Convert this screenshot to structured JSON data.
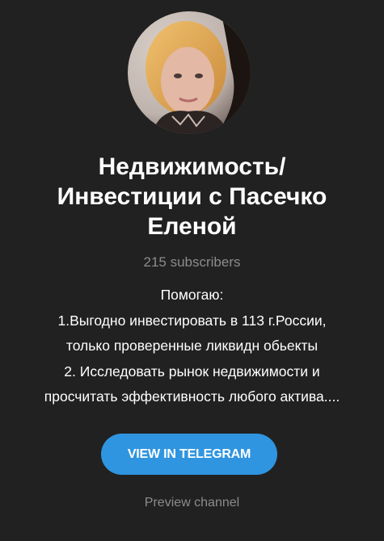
{
  "channel": {
    "title_lines": [
      "Недвижимость/",
      "Инвестиции с Пасечко",
      "Еленой"
    ],
    "subscribers": "215 subscribers",
    "description_lines": [
      "Помогаю:",
      "1.Выгодно инвестировать в 113 г.России,",
      "только проверенные ликвидн обьекты",
      "2. Исследовать рынок недвижимости и",
      "просчитать эффективность любого актива...."
    ]
  },
  "actions": {
    "view_in_telegram": "VIEW IN TELEGRAM",
    "preview_channel": "Preview channel"
  },
  "colors": {
    "background": "#212121",
    "accent": "#2f95e0",
    "muted_text": "#8c8c8c"
  }
}
